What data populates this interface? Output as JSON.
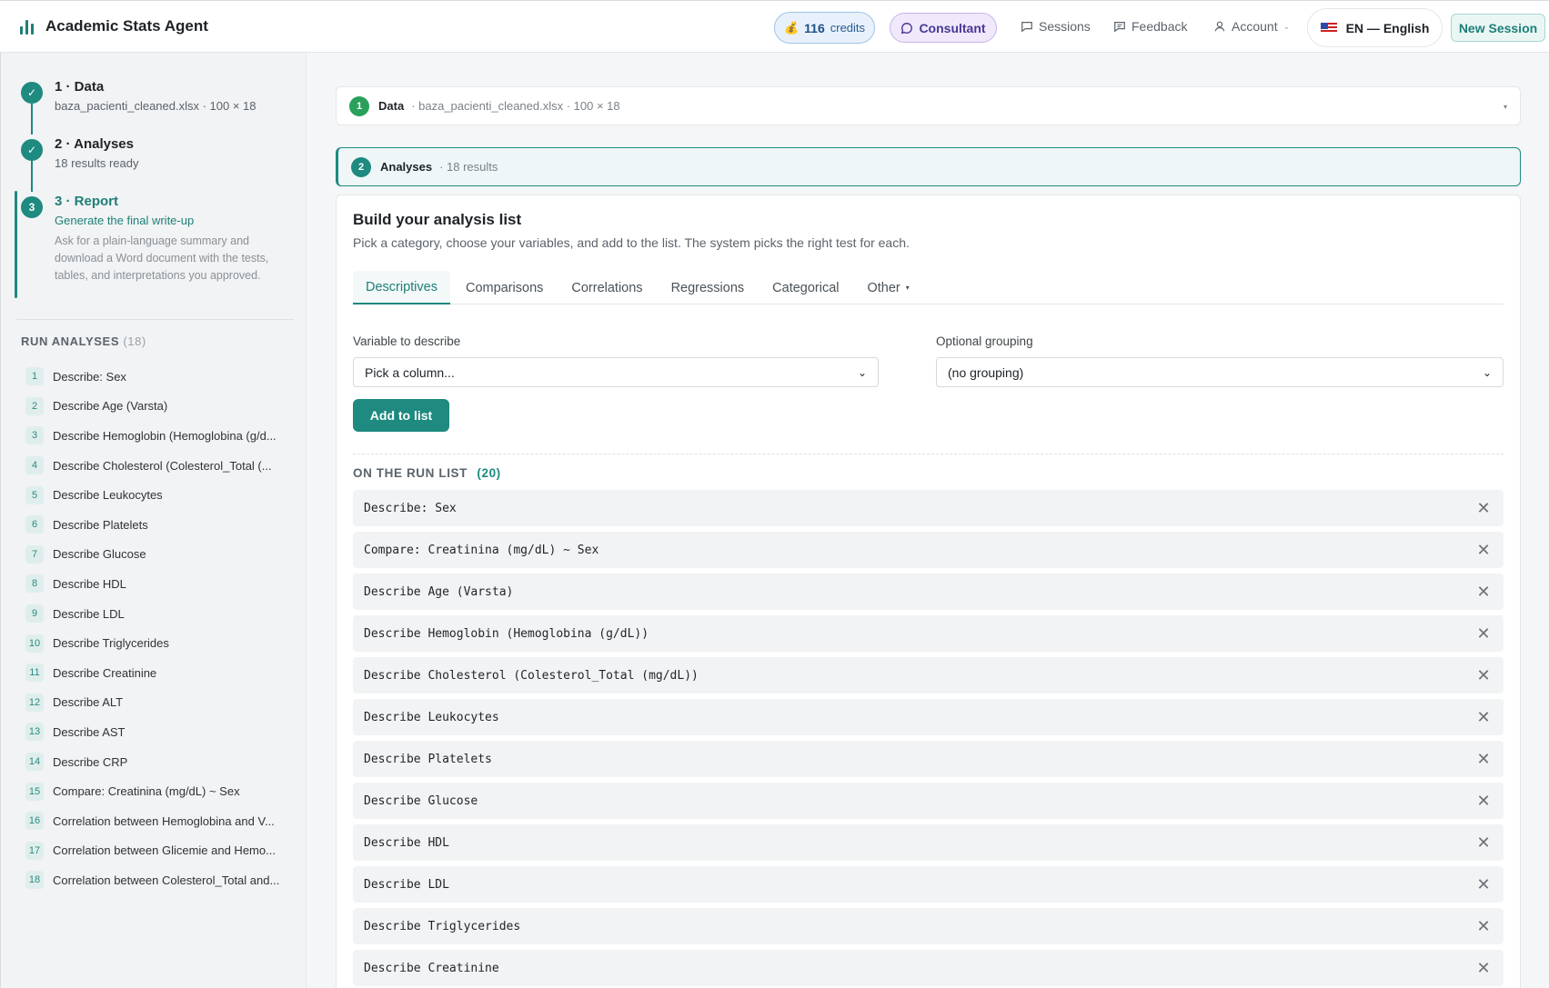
{
  "header": {
    "title": "Academic Stats Agent",
    "credits_count": "116",
    "credits_label": "credits",
    "consultant": "Consultant",
    "sessions": "Sessions",
    "feedback": "Feedback",
    "account": "Account",
    "language": "EN — English",
    "new_session": "New Session"
  },
  "steps": [
    {
      "num": "✓",
      "title": "1 · Data",
      "sub": "baza_pacienti_cleaned.xlsx · 100 × 18"
    },
    {
      "num": "✓",
      "title": "2 · Analyses",
      "sub": "18 results ready"
    },
    {
      "num": "3",
      "title": "3 · Report",
      "sub": "Generate the final write-up",
      "desc": "Ask for a plain-language summary and download a Word document with the tests, tables, and interpretations you approved."
    }
  ],
  "run_analyses": {
    "heading": "RUN ANALYSES",
    "count": "(18)",
    "items": [
      {
        "n": "1",
        "label": "Describe: Sex"
      },
      {
        "n": "2",
        "label": "Describe Age (Varsta)"
      },
      {
        "n": "3",
        "label": "Describe Hemoglobin (Hemoglobina (g/d..."
      },
      {
        "n": "4",
        "label": "Describe Cholesterol (Colesterol_Total (..."
      },
      {
        "n": "5",
        "label": "Describe Leukocytes"
      },
      {
        "n": "6",
        "label": "Describe Platelets"
      },
      {
        "n": "7",
        "label": "Describe Glucose"
      },
      {
        "n": "8",
        "label": "Describe HDL"
      },
      {
        "n": "9",
        "label": "Describe LDL"
      },
      {
        "n": "10",
        "label": "Describe Triglycerides"
      },
      {
        "n": "11",
        "label": "Describe Creatinine"
      },
      {
        "n": "12",
        "label": "Describe ALT"
      },
      {
        "n": "13",
        "label": "Describe AST"
      },
      {
        "n": "14",
        "label": "Describe CRP"
      },
      {
        "n": "15",
        "label": "Compare: Creatinina (mg/dL) ~ Sex"
      },
      {
        "n": "16",
        "label": "Correlation between Hemoglobina and V..."
      },
      {
        "n": "17",
        "label": "Correlation between Glicemie and Hemo..."
      },
      {
        "n": "18",
        "label": "Correlation between Colesterol_Total and..."
      }
    ]
  },
  "data_card": {
    "num": "1",
    "label": "Data",
    "meta": "· baza_pacienti_cleaned.xlsx · 100 × 18"
  },
  "analyses_card": {
    "num": "2",
    "label": "Analyses",
    "meta": "· 18 results"
  },
  "builder": {
    "title": "Build your analysis list",
    "subtitle": "Pick a category, choose your variables, and add to the list. The system picks the right test for each.",
    "tabs": [
      "Descriptives",
      "Comparisons",
      "Correlations",
      "Regressions",
      "Categorical",
      "Other"
    ],
    "variable_label": "Variable to describe",
    "variable_value": "Pick a column...",
    "grouping_label": "Optional grouping",
    "grouping_value": "(no grouping)",
    "add_button": "Add to list",
    "list_heading": "ON THE RUN LIST",
    "list_count": "(20)",
    "queue": [
      "Describe: Sex",
      "Compare: Creatinina (mg/dL) ~ Sex",
      "Describe Age (Varsta)",
      "Describe Hemoglobin (Hemoglobina (g/dL))",
      "Describe Cholesterol (Colesterol_Total (mg/dL))",
      "Describe Leukocytes",
      "Describe Platelets",
      "Describe Glucose",
      "Describe HDL",
      "Describe LDL",
      "Describe Triglycerides",
      "Describe Creatinine"
    ]
  },
  "colors": {
    "accent": "#1e8a80",
    "data_done": "#2aa05a",
    "credits": "#1d4f86",
    "consultant": "#4a3793"
  }
}
